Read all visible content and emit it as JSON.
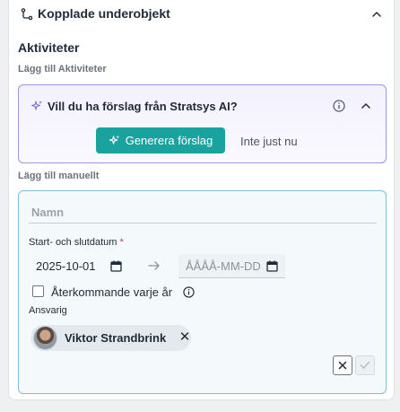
{
  "section": {
    "title": "Kopplade underobjekt"
  },
  "activities": {
    "title": "Aktiviteter",
    "add_label": "Lägg till Aktiviteter"
  },
  "ai": {
    "question": "Vill du ha förslag från Stratsys AI?",
    "generate_label": "Generera förslag",
    "not_now_label": "Inte just nu"
  },
  "manual": {
    "add_label": "Lägg till manuellt",
    "name_placeholder": "Namn",
    "date_label": "Start- och slutdatum",
    "required_mark": "*",
    "start_date": "2025-10-01",
    "end_placeholder": "ÅÅÅÅ-MM-DD",
    "recurring_label": "Återkommande varje år",
    "recurring_checked": false,
    "responsible_label": "Ansvarig",
    "responsible_name": "Viktor Strandbrink"
  },
  "colors": {
    "accent": "#1aa39e",
    "ai_border": "#9c94e6",
    "manual_border": "#7cc3d1",
    "required": "#d63a3a"
  },
  "icons": {
    "section": "link-icon",
    "collapse": "chevron-up-icon",
    "ai": "sparkle-icon",
    "info": "info-icon",
    "calendar": "calendar-icon",
    "arrow": "arrow-right-icon",
    "remove": "close-icon",
    "confirm": "check-icon"
  }
}
